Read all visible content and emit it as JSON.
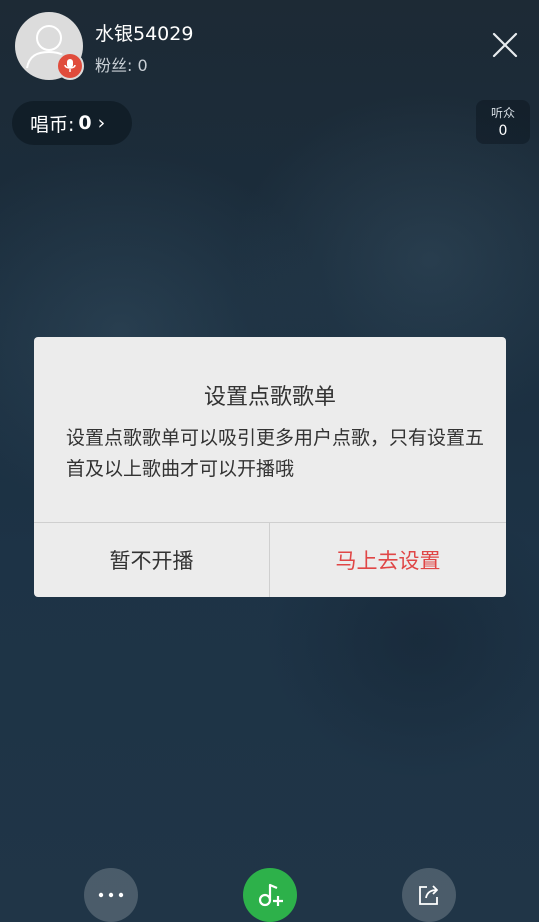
{
  "header": {
    "username": "水银54029",
    "fans_label": "粉丝: 0",
    "close_icon": "close-icon"
  },
  "coins": {
    "label": "唱币:",
    "value": "0",
    "chevron": "›"
  },
  "listeners": {
    "label": "听众",
    "count": "0"
  },
  "dialog": {
    "title": "设置点歌歌单",
    "message": "设置点歌歌单可以吸引更多用户点歌，只有设置五首及以上歌曲才可以开播哦",
    "cancel_label": "暂不开播",
    "confirm_label": "马上去设置"
  },
  "bottom_bar": {
    "more_icon": "more-icon",
    "add_song_icon": "add-song-icon",
    "share_icon": "share-icon"
  },
  "colors": {
    "accent_red": "#e04646",
    "add_song_green": "#2db14a",
    "mic_badge": "#e04c3c"
  }
}
